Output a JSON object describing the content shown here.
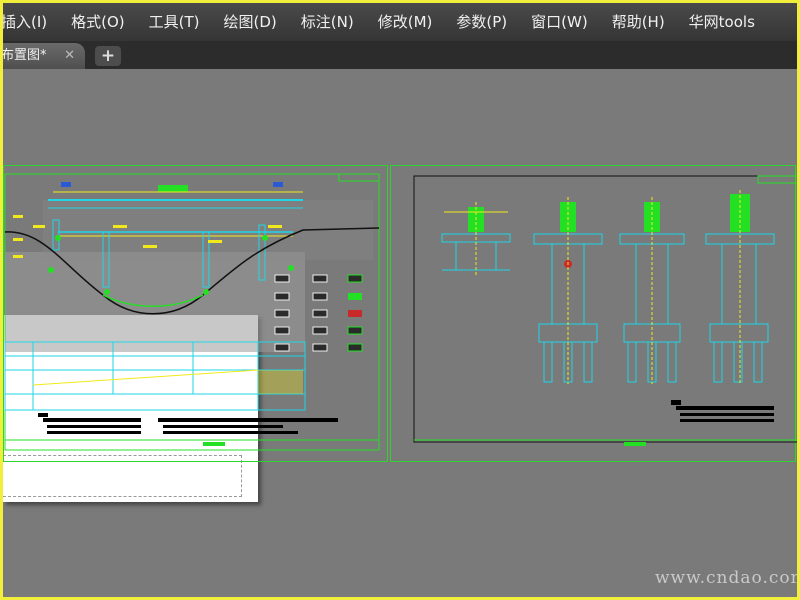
{
  "menu": {
    "items": [
      {
        "label": "插入(I)"
      },
      {
        "label": "格式(O)"
      },
      {
        "label": "工具(T)"
      },
      {
        "label": "绘图(D)"
      },
      {
        "label": "标注(N)"
      },
      {
        "label": "修改(M)"
      },
      {
        "label": "参数(P)"
      },
      {
        "label": "窗口(W)"
      },
      {
        "label": "帮助(H)"
      },
      {
        "label": "华网tools"
      }
    ]
  },
  "tabs": {
    "active_label": "布置图*",
    "close_glyph": "✕",
    "add_glyph": "+"
  },
  "watermark": "www.cndao.com",
  "colors": {
    "canvas": "#7a7a7a",
    "viewport_border": "#2fd32f",
    "drawing_cyan": "#1fd6e6",
    "drawing_yellow": "#f2e91c",
    "drawing_green": "#24e024",
    "screenshot_frame": "#f2ee3c"
  }
}
